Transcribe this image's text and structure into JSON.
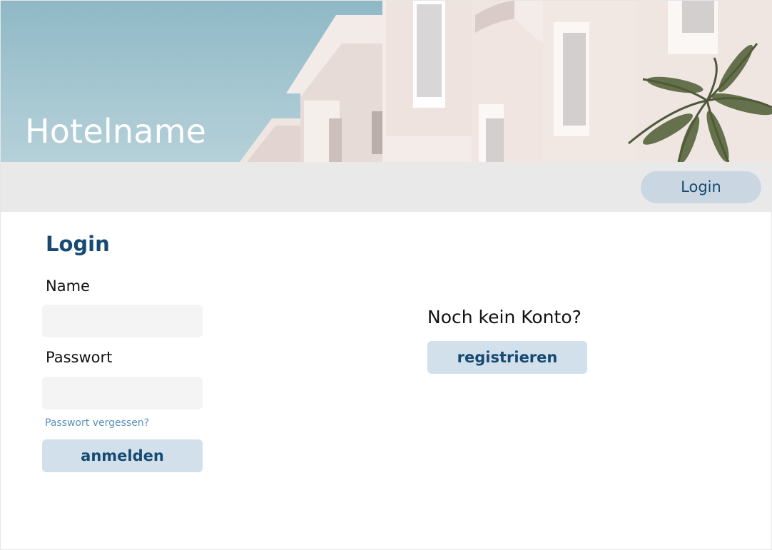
{
  "hero": {
    "title": "Hotelname",
    "image": "hotel-building-with-palm-tree"
  },
  "nav": {
    "login_label": "Login"
  },
  "login_form": {
    "title": "Login",
    "name_label": "Name",
    "name_value": "",
    "password_label": "Passwort",
    "password_value": "",
    "forgot_password_link": "Passwort vergessen?",
    "submit_label": "anmelden"
  },
  "register": {
    "prompt": "Noch kein Konto?",
    "button_label": "registrieren"
  },
  "colors": {
    "accent": "#174a72",
    "button_bg": "#d2e0eb",
    "nav_bg": "#e9e9ea",
    "field_bg": "#f4f4f4",
    "link": "#5a8fc0"
  }
}
